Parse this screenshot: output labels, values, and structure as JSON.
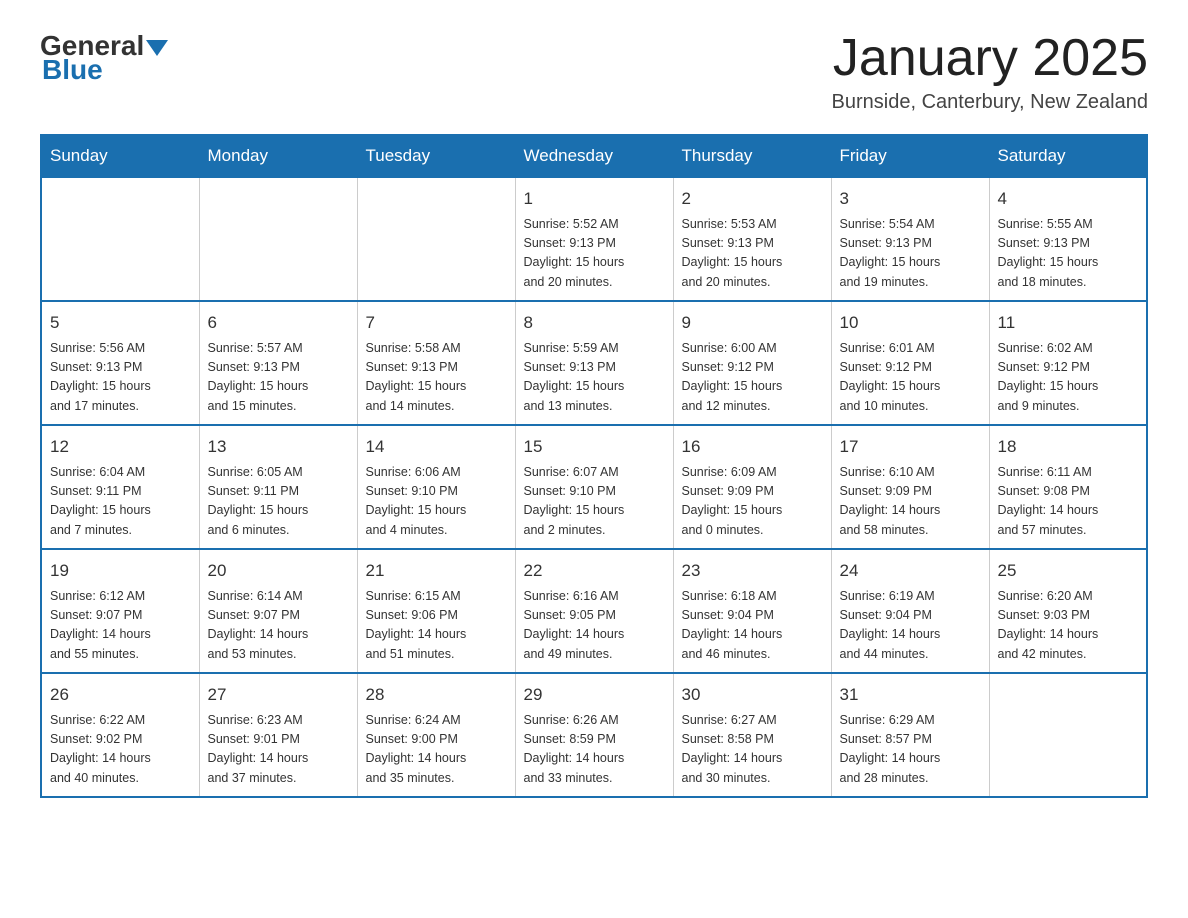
{
  "header": {
    "logo": {
      "general": "General",
      "blue": "Blue"
    },
    "title": "January 2025",
    "location": "Burnside, Canterbury, New Zealand"
  },
  "calendar": {
    "days_of_week": [
      "Sunday",
      "Monday",
      "Tuesday",
      "Wednesday",
      "Thursday",
      "Friday",
      "Saturday"
    ],
    "weeks": [
      [
        {
          "day": "",
          "info": ""
        },
        {
          "day": "",
          "info": ""
        },
        {
          "day": "",
          "info": ""
        },
        {
          "day": "1",
          "info": "Sunrise: 5:52 AM\nSunset: 9:13 PM\nDaylight: 15 hours\nand 20 minutes."
        },
        {
          "day": "2",
          "info": "Sunrise: 5:53 AM\nSunset: 9:13 PM\nDaylight: 15 hours\nand 20 minutes."
        },
        {
          "day": "3",
          "info": "Sunrise: 5:54 AM\nSunset: 9:13 PM\nDaylight: 15 hours\nand 19 minutes."
        },
        {
          "day": "4",
          "info": "Sunrise: 5:55 AM\nSunset: 9:13 PM\nDaylight: 15 hours\nand 18 minutes."
        }
      ],
      [
        {
          "day": "5",
          "info": "Sunrise: 5:56 AM\nSunset: 9:13 PM\nDaylight: 15 hours\nand 17 minutes."
        },
        {
          "day": "6",
          "info": "Sunrise: 5:57 AM\nSunset: 9:13 PM\nDaylight: 15 hours\nand 15 minutes."
        },
        {
          "day": "7",
          "info": "Sunrise: 5:58 AM\nSunset: 9:13 PM\nDaylight: 15 hours\nand 14 minutes."
        },
        {
          "day": "8",
          "info": "Sunrise: 5:59 AM\nSunset: 9:13 PM\nDaylight: 15 hours\nand 13 minutes."
        },
        {
          "day": "9",
          "info": "Sunrise: 6:00 AM\nSunset: 9:12 PM\nDaylight: 15 hours\nand 12 minutes."
        },
        {
          "day": "10",
          "info": "Sunrise: 6:01 AM\nSunset: 9:12 PM\nDaylight: 15 hours\nand 10 minutes."
        },
        {
          "day": "11",
          "info": "Sunrise: 6:02 AM\nSunset: 9:12 PM\nDaylight: 15 hours\nand 9 minutes."
        }
      ],
      [
        {
          "day": "12",
          "info": "Sunrise: 6:04 AM\nSunset: 9:11 PM\nDaylight: 15 hours\nand 7 minutes."
        },
        {
          "day": "13",
          "info": "Sunrise: 6:05 AM\nSunset: 9:11 PM\nDaylight: 15 hours\nand 6 minutes."
        },
        {
          "day": "14",
          "info": "Sunrise: 6:06 AM\nSunset: 9:10 PM\nDaylight: 15 hours\nand 4 minutes."
        },
        {
          "day": "15",
          "info": "Sunrise: 6:07 AM\nSunset: 9:10 PM\nDaylight: 15 hours\nand 2 minutes."
        },
        {
          "day": "16",
          "info": "Sunrise: 6:09 AM\nSunset: 9:09 PM\nDaylight: 15 hours\nand 0 minutes."
        },
        {
          "day": "17",
          "info": "Sunrise: 6:10 AM\nSunset: 9:09 PM\nDaylight: 14 hours\nand 58 minutes."
        },
        {
          "day": "18",
          "info": "Sunrise: 6:11 AM\nSunset: 9:08 PM\nDaylight: 14 hours\nand 57 minutes."
        }
      ],
      [
        {
          "day": "19",
          "info": "Sunrise: 6:12 AM\nSunset: 9:07 PM\nDaylight: 14 hours\nand 55 minutes."
        },
        {
          "day": "20",
          "info": "Sunrise: 6:14 AM\nSunset: 9:07 PM\nDaylight: 14 hours\nand 53 minutes."
        },
        {
          "day": "21",
          "info": "Sunrise: 6:15 AM\nSunset: 9:06 PM\nDaylight: 14 hours\nand 51 minutes."
        },
        {
          "day": "22",
          "info": "Sunrise: 6:16 AM\nSunset: 9:05 PM\nDaylight: 14 hours\nand 49 minutes."
        },
        {
          "day": "23",
          "info": "Sunrise: 6:18 AM\nSunset: 9:04 PM\nDaylight: 14 hours\nand 46 minutes."
        },
        {
          "day": "24",
          "info": "Sunrise: 6:19 AM\nSunset: 9:04 PM\nDaylight: 14 hours\nand 44 minutes."
        },
        {
          "day": "25",
          "info": "Sunrise: 6:20 AM\nSunset: 9:03 PM\nDaylight: 14 hours\nand 42 minutes."
        }
      ],
      [
        {
          "day": "26",
          "info": "Sunrise: 6:22 AM\nSunset: 9:02 PM\nDaylight: 14 hours\nand 40 minutes."
        },
        {
          "day": "27",
          "info": "Sunrise: 6:23 AM\nSunset: 9:01 PM\nDaylight: 14 hours\nand 37 minutes."
        },
        {
          "day": "28",
          "info": "Sunrise: 6:24 AM\nSunset: 9:00 PM\nDaylight: 14 hours\nand 35 minutes."
        },
        {
          "day": "29",
          "info": "Sunrise: 6:26 AM\nSunset: 8:59 PM\nDaylight: 14 hours\nand 33 minutes."
        },
        {
          "day": "30",
          "info": "Sunrise: 6:27 AM\nSunset: 8:58 PM\nDaylight: 14 hours\nand 30 minutes."
        },
        {
          "day": "31",
          "info": "Sunrise: 6:29 AM\nSunset: 8:57 PM\nDaylight: 14 hours\nand 28 minutes."
        },
        {
          "day": "",
          "info": ""
        }
      ]
    ]
  }
}
